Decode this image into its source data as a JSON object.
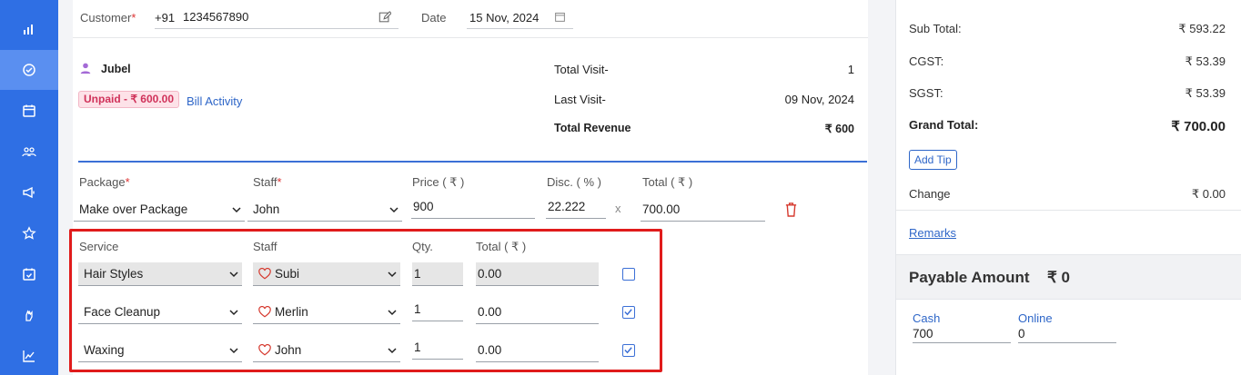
{
  "sidebar": {
    "icons": [
      "chart-bars-icon",
      "check-circle-icon",
      "calendar-icon",
      "group-icon",
      "megaphone-icon",
      "star-icon",
      "calendar-check-icon",
      "hand-icon",
      "trend-icon"
    ]
  },
  "customer": {
    "label": "Customer",
    "required_mark": "*",
    "country_code": "+91",
    "phone": "1234567890",
    "date_label": "Date",
    "date_value": "15 Nov, 2024",
    "name": "Jubel",
    "unpaid_badge": "Unpaid - ₹ 600.00",
    "bill_activity": "Bill Activity",
    "total_visit_label": "Total Visit-",
    "total_visit_value": "1",
    "last_visit_label": "Last Visit-",
    "last_visit_value": "09 Nov, 2024",
    "total_revenue_label": "Total Revenue",
    "total_revenue_value": "₹ 600"
  },
  "package": {
    "package_label": "Package",
    "staff_label": "Staff",
    "price_label": "Price ( ₹ )",
    "disc_label": "Disc. ( % )",
    "total_label": "Total ( ₹ )",
    "package_value": "Make over Package",
    "staff_value": "John",
    "price_value": "900",
    "disc_value": "22.222",
    "x_mark": "x",
    "total_value": "700.00"
  },
  "services": {
    "headers": {
      "service": "Service",
      "staff": "Staff",
      "qty": "Qty.",
      "total": "Total ( ₹ )"
    },
    "rows": [
      {
        "service": "Hair Styles",
        "staff": "Subi",
        "qty": "1",
        "total": "0.00",
        "checked": false
      },
      {
        "service": "Face Cleanup",
        "staff": "Merlin",
        "qty": "1",
        "total": "0.00",
        "checked": true
      },
      {
        "service": "Waxing",
        "staff": "John",
        "qty": "1",
        "total": "0.00",
        "checked": true
      }
    ]
  },
  "summary": {
    "sub_total_label": "Sub Total:",
    "sub_total_value": "₹ 593.22",
    "cgst_label": "CGST:",
    "cgst_value": "₹ 53.39",
    "sgst_label": "SGST:",
    "sgst_value": "₹ 53.39",
    "grand_total_label": "Grand Total:",
    "grand_total_value": "₹ 700.00",
    "add_tip": "Add Tip",
    "change_label": "Change",
    "change_value": "₹ 0.00",
    "remarks": "Remarks",
    "payable_label": "Payable Amount",
    "payable_value": "₹ 0",
    "cash_label": "Cash",
    "cash_value": "700",
    "online_label": "Online",
    "online_value": "0"
  },
  "colors": {
    "sidebar": "#2f6fe4",
    "accent": "#3b6fd6",
    "highlight_border": "#e01b1b",
    "unpaid_bg": "#fde2e8",
    "unpaid_text": "#d0325a",
    "delete": "#d63a2f"
  }
}
